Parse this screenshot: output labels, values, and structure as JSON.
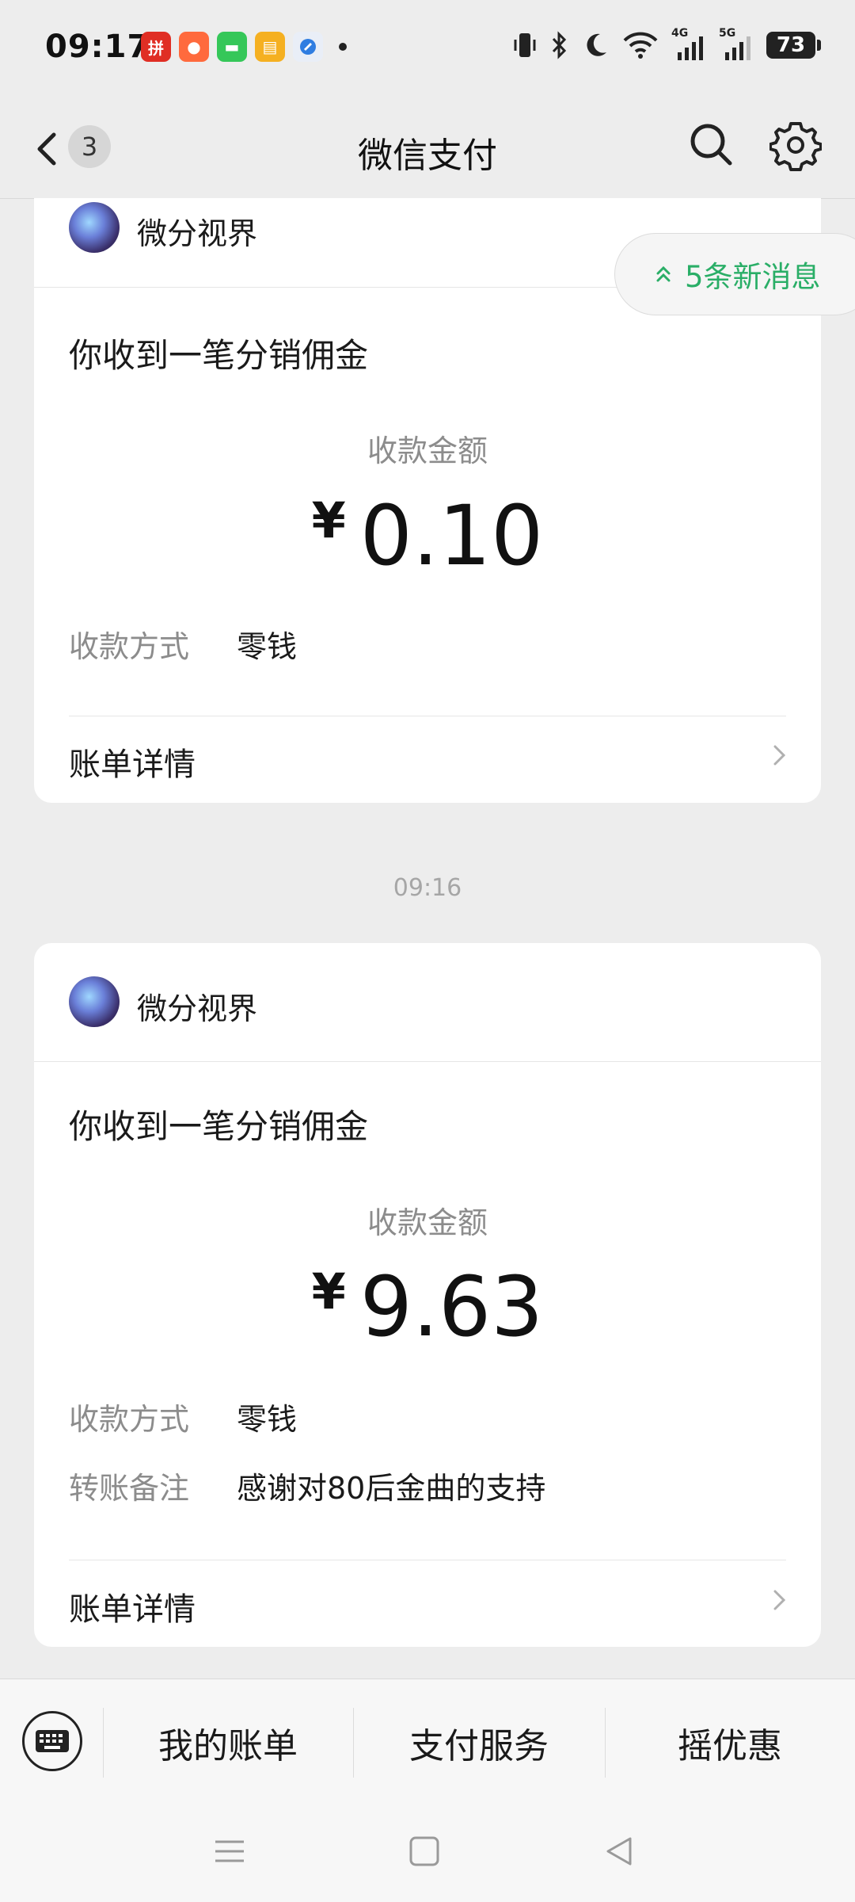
{
  "status_bar": {
    "time": "09:17",
    "battery": "73",
    "network_labels": [
      "4G",
      "5G"
    ],
    "notification_icons": [
      "pinduoduo-icon",
      "game-app-icon",
      "messages-icon",
      "notes-icon",
      "browser-icon"
    ]
  },
  "nav": {
    "title": "微信支付",
    "back_badge": "3",
    "icons": [
      "back-arrow-icon",
      "search-icon",
      "settings-gear-icon"
    ]
  },
  "new_messages": {
    "label": "5条新消息"
  },
  "cards": [
    {
      "merchant": "微分视界",
      "title": "你收到一笔分销佣金",
      "amount_label": "收款金额",
      "currency": "¥",
      "amount": "0.10",
      "rows": [
        {
          "key": "收款方式",
          "value": "零钱"
        }
      ],
      "detail_label": "账单详情"
    },
    {
      "merchant": "微分视界",
      "title": "你收到一笔分销佣金",
      "amount_label": "收款金额",
      "currency": "¥",
      "amount": "9.63",
      "rows": [
        {
          "key": "收款方式",
          "value": "零钱"
        },
        {
          "key": "转账备注",
          "value": "感谢对80后金曲的支持"
        }
      ],
      "detail_label": "账单详情"
    }
  ],
  "timestamp": "09:16",
  "bottom_menu": {
    "items": [
      "我的账单",
      "支付服务",
      "摇优惠"
    ],
    "keyboard_icon": "keyboard-icon"
  },
  "system_nav": [
    "menu-icon",
    "home-icon",
    "back-icon"
  ],
  "colors": {
    "accent_green": "#2aae67",
    "background": "#ededed"
  }
}
